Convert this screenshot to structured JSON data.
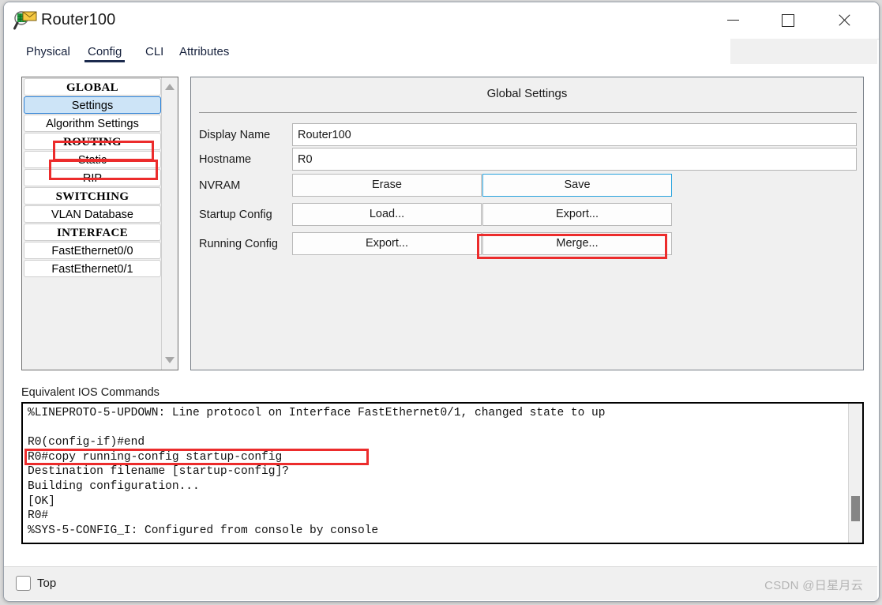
{
  "window": {
    "title": "Router100",
    "icon": "packet-tracer-inspect-icon",
    "controls": {
      "minimize": "—",
      "maximize": "□",
      "close": "×"
    }
  },
  "tabs": [
    {
      "label": "Physical",
      "active": false
    },
    {
      "label": "Config",
      "active": true
    },
    {
      "label": "CLI",
      "active": false
    },
    {
      "label": "Attributes",
      "active": false
    }
  ],
  "sidebar": {
    "items": [
      {
        "label": "GLOBAL",
        "type": "header",
        "selected": false
      },
      {
        "label": "Settings",
        "type": "item",
        "selected": true
      },
      {
        "label": "Algorithm Settings",
        "type": "item",
        "selected": false
      },
      {
        "label": "ROUTING",
        "type": "header",
        "selected": false
      },
      {
        "label": "Static",
        "type": "item",
        "selected": false
      },
      {
        "label": "RIP",
        "type": "item",
        "selected": false
      },
      {
        "label": "SWITCHING",
        "type": "header",
        "selected": false
      },
      {
        "label": "VLAN Database",
        "type": "item",
        "selected": false
      },
      {
        "label": "INTERFACE",
        "type": "header",
        "selected": false
      },
      {
        "label": "FastEthernet0/0",
        "type": "item",
        "selected": false
      },
      {
        "label": "FastEthernet0/1",
        "type": "item",
        "selected": false
      }
    ],
    "scrollbar": {
      "up": "scroll-up-arrow",
      "down": "scroll-down-arrow"
    }
  },
  "settings": {
    "panel_title": "Global Settings",
    "display_name": {
      "label": "Display Name",
      "value": "Router100"
    },
    "hostname": {
      "label": "Hostname",
      "value": "R0"
    },
    "nvram": {
      "label": "NVRAM",
      "erase": "Erase",
      "save": "Save"
    },
    "startup_config": {
      "label": "Startup Config",
      "load": "Load...",
      "export": "Export..."
    },
    "running_config": {
      "label": "Running Config",
      "export": "Export...",
      "merge": "Merge..."
    }
  },
  "console": {
    "label": "Equivalent IOS Commands",
    "lines": "%LINEPROTO-5-UPDOWN: Line protocol on Interface FastEthernet0/1, changed state to up\n\nR0(config-if)#end\nR0#copy running-config startup-config\nDestination filename [startup-config]?\nBuilding configuration...\n[OK]\nR0#\n%SYS-5-CONFIG_I: Configured from console by console"
  },
  "footer": {
    "top_checkbox_label": "Top",
    "top_checked": false,
    "watermark": "CSDN @日星月云"
  },
  "colors": {
    "annotation_red": "#ec2c2c",
    "selection_blue": "#cde4f7",
    "tab_active": "#1b2a4d",
    "focus_blue": "#29a3dd"
  }
}
